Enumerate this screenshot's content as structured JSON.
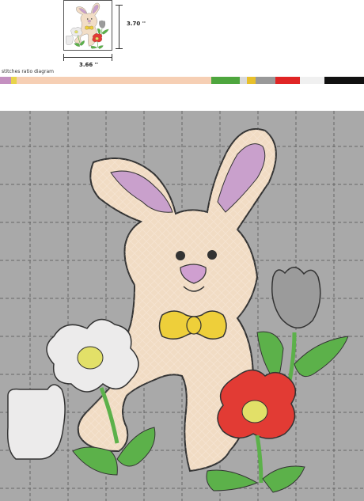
{
  "preview": {
    "height_label": "3.70 ''",
    "width_label": "3.66 ''"
  },
  "ratio": {
    "label": "stitches ratio diagram",
    "segments": [
      {
        "color": "#c490c0",
        "weight": 2.5
      },
      {
        "color": "#e8d44a",
        "weight": 1.2
      },
      {
        "color": "#f6cfb4",
        "weight": 44
      },
      {
        "color": "#4ea63e",
        "weight": 6.5
      },
      {
        "color": "#d9d9d9",
        "weight": 1.5
      },
      {
        "color": "#e8c02a",
        "weight": 2
      },
      {
        "color": "#999999",
        "weight": 4.5
      },
      {
        "color": "#e02525",
        "weight": 5.5
      },
      {
        "color": "#f0f0f0",
        "weight": 5.5
      },
      {
        "color": "#111111",
        "weight": 9
      }
    ]
  },
  "design": {
    "subject": "embroidered Easter bunny with bow tie, flowers and tulip",
    "colors": {
      "body": "#f1dcc4",
      "ear_inner": "#c9a0cc",
      "nose": "#cf9fd0",
      "bow": "#eecf3a",
      "flower_red": "#e23b34",
      "flower_white": "#ecebeb",
      "flower_center": "#e2e068",
      "tulip": "#9b9b9b",
      "leaf": "#5cb14a",
      "outline": "#333333",
      "hoop_background": "#a9a9a9"
    }
  }
}
